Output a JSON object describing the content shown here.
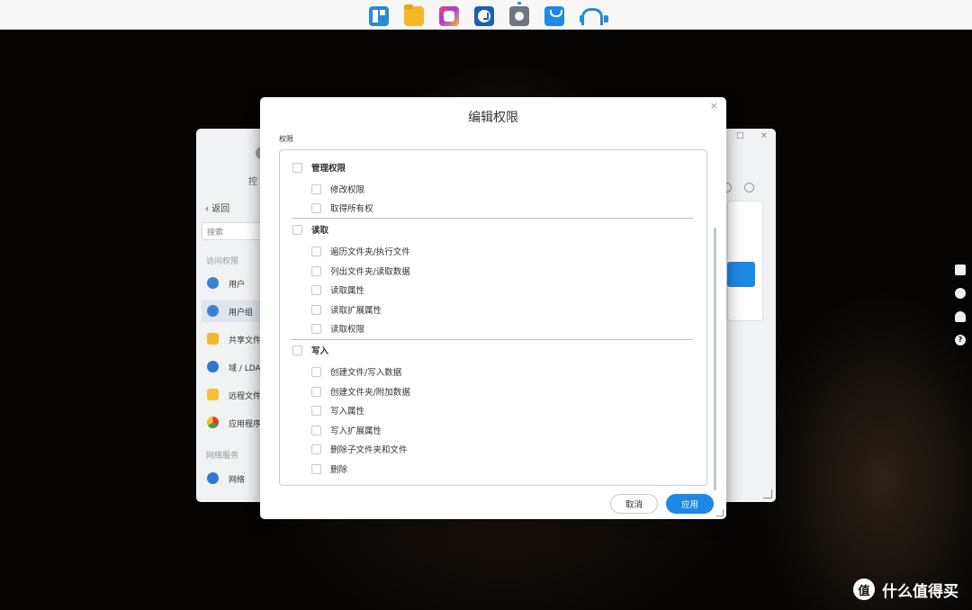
{
  "taskbar": {
    "apps": [
      "dsm-main-menu-icon",
      "file-station-icon",
      "photos-icon",
      "clock-icon",
      "control-panel-gear-icon",
      "package-center-icon",
      "support-headset-icon"
    ]
  },
  "background_window": {
    "title": "控",
    "back_label": "返回",
    "search_placeholder": "搜索",
    "sections": {
      "access": "访问权限",
      "network": "网络服务"
    },
    "nav_items": [
      {
        "label": "用户"
      },
      {
        "label": "用户组"
      },
      {
        "label": "共享文件"
      },
      {
        "label": "域 / LDA"
      },
      {
        "label": "远程文件"
      },
      {
        "label": "应用程序"
      },
      {
        "label": "网络"
      }
    ]
  },
  "dialog": {
    "title": "编辑权限",
    "section_label": "权限",
    "groups": [
      {
        "label": "管理权限",
        "items": [
          "修改权限",
          "取得所有权"
        ]
      },
      {
        "label": "读取",
        "items": [
          "遍历文件夹/执行文件",
          "列出文件夹/读取数据",
          "读取属性",
          "读取扩展属性",
          "读取权限"
        ]
      },
      {
        "label": "写入",
        "items": [
          "创建文件/写入数据",
          "创建文件夹/附加数据",
          "写入属性",
          "写入扩展属性",
          "删除子文件夹和文件",
          "删除"
        ]
      }
    ],
    "buttons": {
      "cancel": "取消",
      "apply": "应用"
    },
    "close_glyph": "×"
  },
  "side_widgets": {
    "help_glyph": "?"
  },
  "watermark": {
    "logo_glyph": "值",
    "text": "什么值得买"
  },
  "colors": {
    "accent": "#1e88e5",
    "taskbar": "#f7f7f7",
    "dialog_bg": "#ffffff"
  }
}
